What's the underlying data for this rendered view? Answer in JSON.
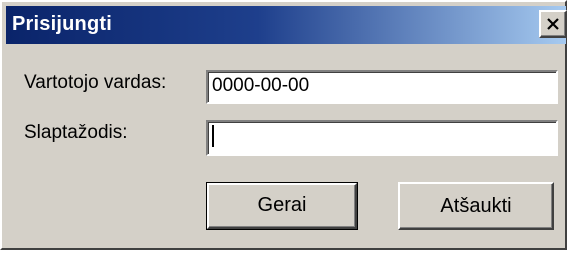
{
  "window": {
    "title": "Prisijungti",
    "close_icon": "close-icon"
  },
  "form": {
    "username_label": "Vartotojo vardas:",
    "username_value": "0000-00-00",
    "password_label": "Slaptažodis:",
    "password_value": ""
  },
  "buttons": {
    "ok_label": "Gerai",
    "cancel_label": "Atšaukti"
  }
}
